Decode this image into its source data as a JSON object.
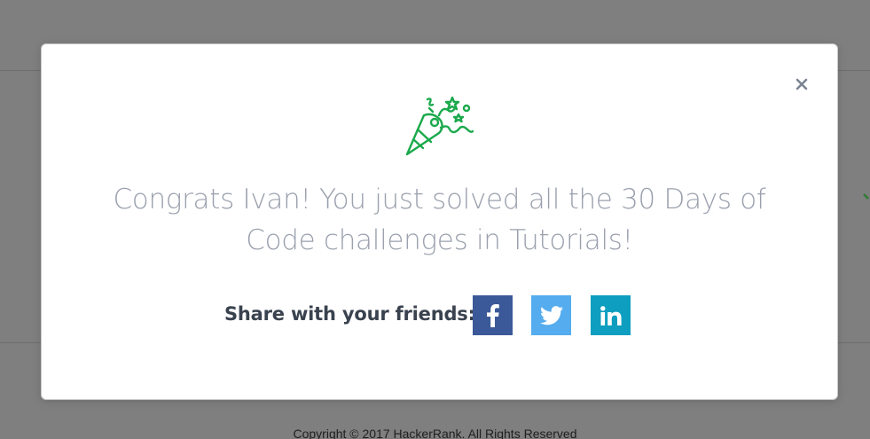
{
  "modal": {
    "message": "Congrats Ivan! You just solved all the 30 Days of Code challenges in Tutorials!",
    "share_label": "Share with your friends:",
    "close_label": "×"
  },
  "social": [
    {
      "name": "facebook",
      "icon": "facebook-icon",
      "color": "#3b5998"
    },
    {
      "name": "twitter",
      "icon": "twitter-icon",
      "color": "#55acee"
    },
    {
      "name": "linkedin",
      "icon": "linkedin-icon",
      "color": "#0e9ebf"
    }
  ],
  "footer": {
    "copyright": "Copyright © 2017 HackerRank. All Rights Reserved"
  },
  "colors": {
    "overlay": "#7f7f7f",
    "accent_green": "#1ba94c",
    "message_text": "#9aa0ad"
  }
}
